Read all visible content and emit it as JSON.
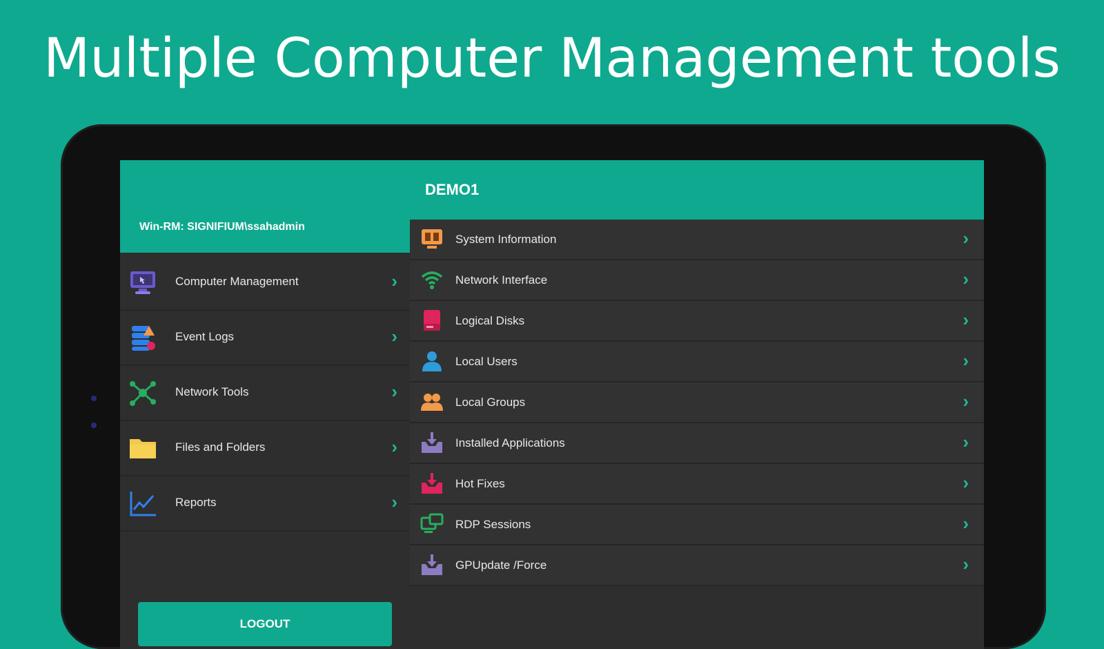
{
  "headline": "Multiple Computer Management tools",
  "left_panel": {
    "connection": "Win-RM: SIGNIFIUM\\ssahadmin",
    "items": [
      {
        "label": "Computer Management",
        "icon": "monitor-icon"
      },
      {
        "label": "Event Logs",
        "icon": "event-logs-icon"
      },
      {
        "label": "Network Tools",
        "icon": "network-tools-icon"
      },
      {
        "label": "Files and Folders",
        "icon": "folder-icon"
      },
      {
        "label": "Reports",
        "icon": "chart-icon"
      }
    ],
    "logout_label": "LOGOUT"
  },
  "right_panel": {
    "title": "DEMO1",
    "items": [
      {
        "label": "System Information",
        "icon": "system-info-icon"
      },
      {
        "label": "Network Interface",
        "icon": "wifi-icon"
      },
      {
        "label": "Logical Disks",
        "icon": "disk-icon"
      },
      {
        "label": "Local Users",
        "icon": "user-icon"
      },
      {
        "label": "Local Groups",
        "icon": "group-icon"
      },
      {
        "label": "Installed Applications",
        "icon": "install-icon"
      },
      {
        "label": "Hot Fixes",
        "icon": "hotfix-icon"
      },
      {
        "label": "RDP Sessions",
        "icon": "rdp-icon"
      },
      {
        "label": "GPUpdate /Force",
        "icon": "gpupdate-icon"
      }
    ]
  },
  "colors": {
    "accent": "#0fa98f",
    "panel": "#2e2e2e",
    "chevron": "#1fb89b"
  }
}
